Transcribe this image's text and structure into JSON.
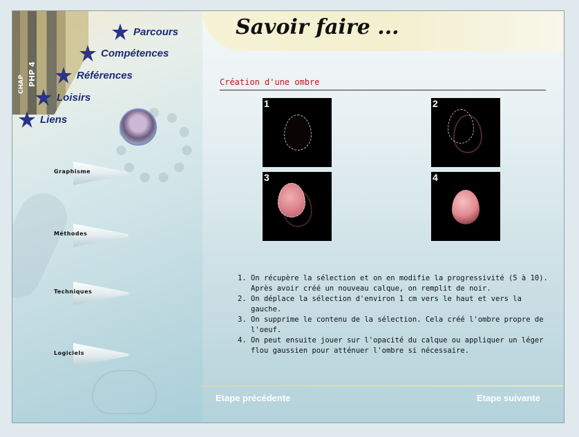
{
  "header": {
    "title": "Savoir faire ..."
  },
  "top_nav": [
    {
      "label": "Parcours",
      "icon": "star-icon"
    },
    {
      "label": "Compétences",
      "icon": "star-icon"
    },
    {
      "label": "Références",
      "icon": "star-icon"
    },
    {
      "label": "Loisirs",
      "icon": "star-icon"
    },
    {
      "label": "Liens",
      "icon": "star-icon"
    }
  ],
  "side_nav": [
    {
      "label": "Graphisme"
    },
    {
      "label": "Méthodes"
    },
    {
      "label": "Techniques"
    },
    {
      "label": "Logiciels"
    }
  ],
  "books_text": [
    "PHP 4",
    "CHAP"
  ],
  "main": {
    "section_title": "Création d'une ombre",
    "screenshots": [
      {
        "number": "1"
      },
      {
        "number": "2"
      },
      {
        "number": "3"
      },
      {
        "number": "4"
      }
    ],
    "steps": [
      "On récupère la sélection et on en modifie la progressivité (5 à 10). Après avoir créé un nouveau calque, on remplit de noir.",
      "On déplace la sélection d'environ 1 cm vers le haut et vers la gauche.",
      "On supprime le contenu de la sélection. Cela créé l'ombre propre de l'oeuf.",
      "On peut ensuite jouer sur l'opacité du calque ou appliquer un léger flou gaussien pour atténuer l'ombre si nécessaire."
    ]
  },
  "footer": {
    "prev_label": "Etape précédente",
    "next_label": "Etape suivante"
  },
  "colors": {
    "nav_text": "#1b2a78",
    "section_title": "#c0141a",
    "footer_link": "#ffffff",
    "header_bg": "#f3efcf"
  }
}
